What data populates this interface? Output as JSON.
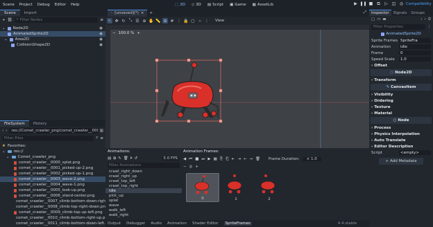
{
  "menu": [
    "Scene",
    "Project",
    "Debug",
    "Editor",
    "Help"
  ],
  "workspaces": [
    {
      "label": "2D",
      "active": true
    },
    {
      "label": "3D",
      "active": false
    },
    {
      "label": "Script",
      "active": false
    },
    {
      "label": "Game",
      "active": false
    },
    {
      "label": "AssetLib",
      "active": false
    }
  ],
  "renderer": "Compatibility",
  "scene_dock": {
    "tabs": [
      "Scene",
      "Import"
    ],
    "filter_placeholder": "Filter Nodes",
    "tree": [
      {
        "label": "Node2D",
        "depth": 0,
        "color": "#8da5f3",
        "selected": false
      },
      {
        "label": "AnimatedSprite2D",
        "depth": 1,
        "color": "#8da5f3",
        "selected": true
      },
      {
        "label": "Area2D",
        "depth": 1,
        "color": "#8da5f3",
        "selected": false
      },
      {
        "label": "CollisionShape2D",
        "depth": 2,
        "color": "#8da5f3",
        "selected": false
      }
    ]
  },
  "fs_dock": {
    "tabs": [
      "FileSystem",
      "History"
    ],
    "path": "res://Comet_crawler_png/comet_crawler__0003_wa",
    "filter_placeholder": "Filter Files",
    "favorites": "Favorites:",
    "root": "res://",
    "folder": "Comet_crawler_png",
    "files": [
      "comet_crawler__0000_splat.png",
      "comet_crawler__0001_picked-up-2.png",
      "comet_crawler__0002_picked-up-1.png",
      "comet_crawler__0003_wave-2.png",
      "comet_crawler__0004_wave-1.png",
      "comet_crawler__0005_look-up.png",
      "comet_crawler__0006_stand-center.png",
      "comet_crawler__0007_climb-bottom-down-right.png",
      "comet_crawler__0008_climb-top-right-down.png",
      "comet_crawler__0009_climb-top-up-left.png",
      "comet_crawler__0010_climb-bottom-right-up.png",
      "comet_crawler__0011_climb-bottom-down-left.png",
      "comet_crawler__0012_climb-top-right-down.png",
      "comet_crawler__0013_climb-top-up-right.png"
    ],
    "selected_index": 3
  },
  "scene_tab": "[unsaved](*)",
  "viewport": {
    "zoom": "100.0 %",
    "view_label": "View"
  },
  "animations": {
    "title": "Animations:",
    "filter_placeholder": "Filter Animations",
    "fps": "5.0 FPS",
    "items": [
      "crawl_right_down",
      "crawl_right_up",
      "crawl_top_left",
      "crawl_top_right",
      "idle",
      "pick_up",
      "splat",
      "wave",
      "walk_left",
      "walk_right"
    ],
    "selected": "idle"
  },
  "frames": {
    "title": "Animation Frames:",
    "duration_label": "Frame Duration:",
    "duration": "1.0",
    "items": [
      "0",
      "1",
      "2"
    ],
    "selected": 0
  },
  "bottom_tabs": [
    "Output",
    "Debugger",
    "Audio",
    "Animation",
    "Shader Editor",
    "SpriteFrames"
  ],
  "bottom_active": "SpriteFrames",
  "version": "4.4.stable",
  "inspector": {
    "tabs": [
      "Inspector",
      "Signals",
      "Groups"
    ],
    "filter_placeholder": "Filter Properties",
    "object": "AnimatedSprite2D",
    "props": [
      {
        "label": "Sprite Frames",
        "value": "SpriteFra"
      },
      {
        "label": "Animation",
        "value": "idle"
      },
      {
        "label": "Frame",
        "value": "0"
      },
      {
        "label": "Speed Scale",
        "value": "1.0"
      }
    ],
    "offset": "Offset",
    "node2d": "Node2D",
    "transform": "Transform",
    "canvasitem": "CanvasItem",
    "canvas_sections": [
      "Visibility",
      "Ordering",
      "Texture",
      "Material"
    ],
    "node": "Node",
    "node_sections": [
      "Process",
      "Physics Interpolation",
      "Auto Translate",
      "Editor Description"
    ],
    "script_label": "Script",
    "script_value": "<empty>",
    "add_metadata": "Add Metadata"
  },
  "colors": {
    "accent": "#4a90e2",
    "robot_red": "#d9302a",
    "selection": "#364c66"
  }
}
